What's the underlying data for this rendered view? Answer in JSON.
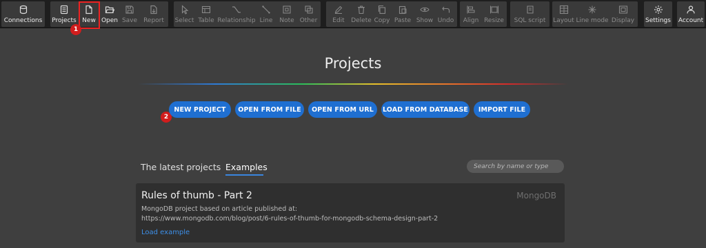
{
  "toolbar": {
    "connections": "Connections",
    "projects": "Projects",
    "new": "New",
    "open": "Open",
    "save": "Save",
    "report": "Report",
    "select": "Select",
    "table": "Table",
    "relationship": "Relationship",
    "line": "Line",
    "note": "Note",
    "other": "Other",
    "edit": "Edit",
    "delete": "Delete",
    "copy": "Copy",
    "paste": "Paste",
    "show": "Show",
    "undo": "Undo",
    "align": "Align",
    "resize": "Resize",
    "sql_script": "SQL script",
    "layout": "Layout",
    "line_mode": "Line mode",
    "display": "Display",
    "settings": "Settings",
    "account": "Account"
  },
  "markers": {
    "one": "1",
    "two": "2"
  },
  "main": {
    "title": "Projects",
    "buttons": {
      "new_project": "NEW PROJECT",
      "open_from_file": "OPEN FROM FILE",
      "open_from_url": "OPEN FROM URL",
      "load_from_database": "LOAD FROM DATABASE",
      "import_file": "IMPORT FILE"
    },
    "tabs": {
      "latest": "The latest projects",
      "examples": "Examples"
    },
    "search_placeholder": "Search by name or type",
    "card": {
      "title": "Rules of thumb - Part 2",
      "db": "MongoDB",
      "desc_line1": "MongoDB project based on article published at:",
      "desc_line2": "https://www.mongodb.com/blog/post/6-rules-of-thumb-for-mongodb-schema-design-part-2",
      "link": "Load example"
    }
  },
  "colors": {
    "accent": "#1f6fd1",
    "link": "#3d8fe8",
    "marker": "#d11d1d",
    "toolbar_bg": "#1e1e1e",
    "page_bg": "#3f3f3f"
  }
}
